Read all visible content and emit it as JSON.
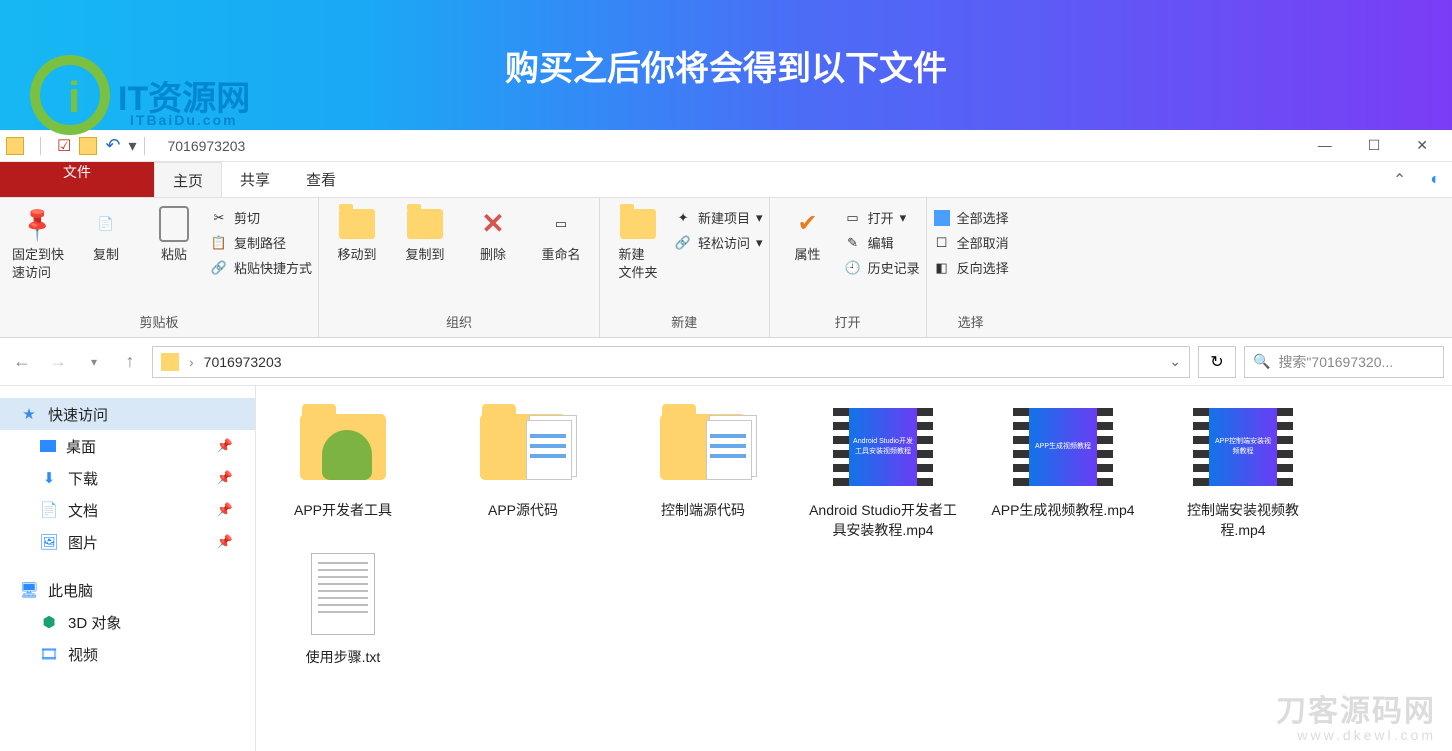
{
  "banner": {
    "headline": "购买之后你将会得到以下文件",
    "logo_text": "IT资源网",
    "logo_sub": "ITBaiDu.com"
  },
  "titlebar": {
    "window_title": "7016973203"
  },
  "window_controls": {
    "minimize": "—",
    "maximize": "☐",
    "close": "✕"
  },
  "tabs": {
    "file": "文件",
    "home": "主页",
    "share": "共享",
    "view": "查看"
  },
  "ribbon": {
    "clipboard": {
      "pin": "固定到快\n速访问",
      "copy": "复制",
      "paste": "粘贴",
      "cut": "剪切",
      "copy_path": "复制路径",
      "paste_shortcut": "粘贴快捷方式",
      "group": "剪贴板"
    },
    "organize": {
      "move_to": "移动到",
      "copy_to": "复制到",
      "delete": "删除",
      "rename": "重命名",
      "group": "组织"
    },
    "new": {
      "new_folder": "新建\n文件夹",
      "new_item": "新建项目",
      "easy_access": "轻松访问",
      "group": "新建"
    },
    "open": {
      "properties": "属性",
      "open": "打开",
      "edit": "编辑",
      "history": "历史记录",
      "group": "打开"
    },
    "select": {
      "select_all": "全部选择",
      "select_none": "全部取消",
      "invert": "反向选择",
      "group": "选择"
    }
  },
  "address": {
    "path": "7016973203",
    "search_placeholder": "搜索\"701697320..."
  },
  "nav": {
    "quick_access": "快速访问",
    "desktop": "桌面",
    "downloads": "下载",
    "documents": "文档",
    "pictures": "图片",
    "this_pc": "此电脑",
    "objects_3d": "3D 对象",
    "videos": "视频"
  },
  "files": [
    {
      "name": "APP开发者工具",
      "type": "folder-android"
    },
    {
      "name": "APP源代码",
      "type": "folder-open"
    },
    {
      "name": "控制端源代码",
      "type": "folder-open"
    },
    {
      "name": "Android Studio开发者工具安装教程.mp4",
      "type": "video",
      "caption": "Android Studio开发工具安装视频教程"
    },
    {
      "name": "APP生成视频教程.mp4",
      "type": "video",
      "caption": "APP生成视频教程"
    },
    {
      "name": "控制端安装视频教程.mp4",
      "type": "video",
      "caption": "APP控制端安装视频教程"
    },
    {
      "name": "使用步骤.txt",
      "type": "txt"
    }
  ],
  "watermark": {
    "brand": "刀客源码网",
    "url": "www.dkewl.com"
  }
}
